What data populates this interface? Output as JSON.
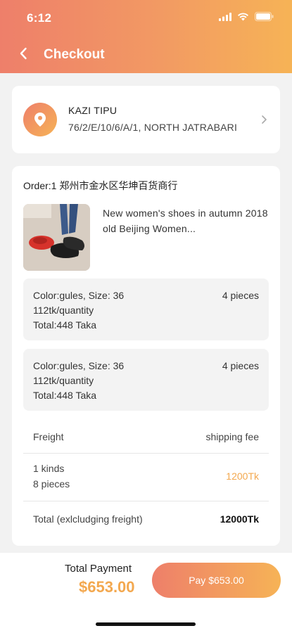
{
  "status_bar": {
    "time": "6:12",
    "icons": [
      "signal-icon",
      "wifi-icon",
      "battery-icon"
    ]
  },
  "nav": {
    "back_icon": "chevron-left-icon",
    "title": "Checkout"
  },
  "address": {
    "icon": "location-pin-icon",
    "name": "KAZI TIPU",
    "line": " 76/2/E/10/6/A/1, NORTH JATRABARI",
    "chevron_icon": "chevron-right-icon"
  },
  "order": {
    "title": "Order:1 郑州市金水区华坤百货商行",
    "product": {
      "image_icon": "product-thumbnail",
      "name": "New women's shoes in autumn 2018 old Beijing Women..."
    },
    "specs": [
      {
        "variant": "Color:gules, Size: 36",
        "quantity": "4 pieces",
        "unit_price": "112tk/quantity",
        "total": "Total:448 Taka"
      },
      {
        "variant": "Color:gules, Size: 36",
        "quantity": "4 pieces",
        "unit_price": "112tk/quantity",
        "total": "Total:448 Taka"
      }
    ],
    "freight": {
      "label": "Freight",
      "value": "shipping fee"
    },
    "summary": {
      "kinds": "1 kinds",
      "pieces": "8 pieces",
      "amount": "1200Tk"
    },
    "total": {
      "label": "Total (exlcludging freight)",
      "value": "12000Tk"
    }
  },
  "payment": {
    "label": "Total Payment",
    "amount": "$653.00",
    "button": "Pay $653.00"
  },
  "colors": {
    "gradient_start": "#ee7f6a",
    "gradient_end": "#f6b356",
    "accent_amount": "#f3a84f",
    "background": "#f2f2f2"
  }
}
